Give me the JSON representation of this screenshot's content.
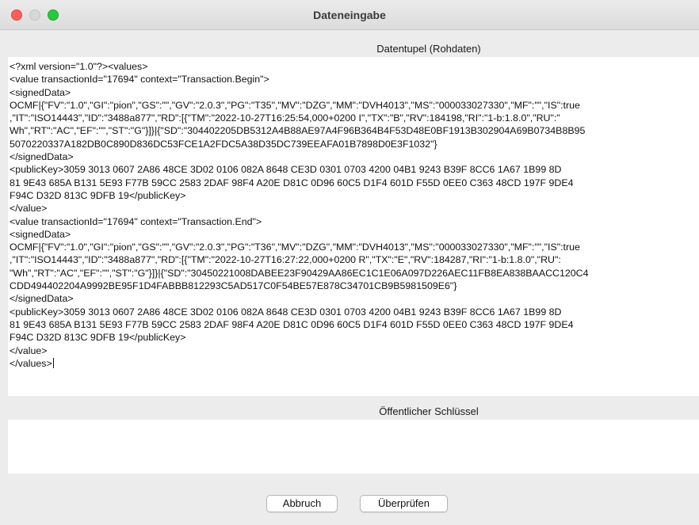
{
  "window": {
    "title": "Dateneingabe"
  },
  "raw_section": {
    "header": "Datentupel (Rohdaten)",
    "lines": [
      "<?xml version=\"1.0\"?><values>",
      "<value transactionId=\"17694\" context=\"Transaction.Begin\">",
      "<signedData>",
      "OCMF|{\"FV\":\"1.0\",\"GI\":\"pion\",\"GS\":\"\",\"GV\":\"2.0.3\",\"PG\":\"T35\",\"MV\":\"DZG\",\"MM\":\"DVH4013\",\"MS\":\"000033027330\",\"MF\":\"\",\"IS\":true",
      ",\"IT\":\"ISO14443\",\"ID\":\"3488a877\",\"RD\":[{\"TM\":\"2022-10-27T16:25:54,000+0200 I\",\"TX\":\"B\",\"RV\":184198,\"RI\":\"1-b:1.8.0\",\"RU\":\"",
      "Wh\",\"RT\":\"AC\",\"EF\":\"\",\"ST\":\"G\"}]}|{\"SD\":\"304402205DB5312A4B88AE97A4F96B364B4F53D48E0BF1913B302904A69B0734B8B95",
      "5070220337A182DB0C890D836DC53FCE1A2FDC5A38D35DC739EEAFA01B7898D0E3F1032\"}",
      "</signedData>",
      "<publicKey>3059 3013 0607 2A86 48CE 3D02 0106 082A 8648 CE3D 0301 0703 4200 04B1 9243 B39F 8CC6 1A67 1B99 8D",
      "81 9E43 685A B131 5E93 F77B 59CC 2583 2DAF 98F4 A20E D81C 0D96 60C5 D1F4 601D F55D 0EE0 C363 48CD 197F 9DE4",
      "F94C D32D 813C 9DFB 19</publicKey>",
      "</value>",
      "<value transactionId=\"17694\" context=\"Transaction.End\">",
      "<signedData>",
      "OCMF|{\"FV\":\"1.0\",\"GI\":\"pion\",\"GS\":\"\",\"GV\":\"2.0.3\",\"PG\":\"T36\",\"MV\":\"DZG\",\"MM\":\"DVH4013\",\"MS\":\"000033027330\",\"MF\":\"\",\"IS\":true",
      ",\"IT\":\"ISO14443\",\"ID\":\"3488a877\",\"RD\":[{\"TM\":\"2022-10-27T16:27:22,000+0200 R\",\"TX\":\"E\",\"RV\":184287,\"RI\":\"1-b:1.8.0\",\"RU\":",
      "\"Wh\",\"RT\":\"AC\",\"EF\":\"\",\"ST\":\"G\"}]}|{\"SD\":\"30450221008DABEE23F90429AA86EC1C1E06A097D226AEC11FB8EA838BAACC120C4",
      "CDD494402204A9992BE95F1D4FABBB812293C5AD517C0F54BE57E878C34701CB9B5981509E6\"}",
      "</signedData>",
      "<publicKey>3059 3013 0607 2A86 48CE 3D02 0106 082A 8648 CE3D 0301 0703 4200 04B1 9243 B39F 8CC6 1A67 1B99 8D",
      "81 9E43 685A B131 5E93 F77B 59CC 2583 2DAF 98F4 A20E D81C 0D96 60C5 D1F4 601D F55D 0EE0 C363 48CD 197F 9DE4",
      "F94C D32D 813C 9DFB 19</publicKey>",
      "</value>",
      "</values>"
    ]
  },
  "public_key_section": {
    "header": "Öffentlicher Schlüssel",
    "value": ""
  },
  "buttons": {
    "cancel_label": "Abbruch",
    "verify_label": "Überprüfen"
  }
}
